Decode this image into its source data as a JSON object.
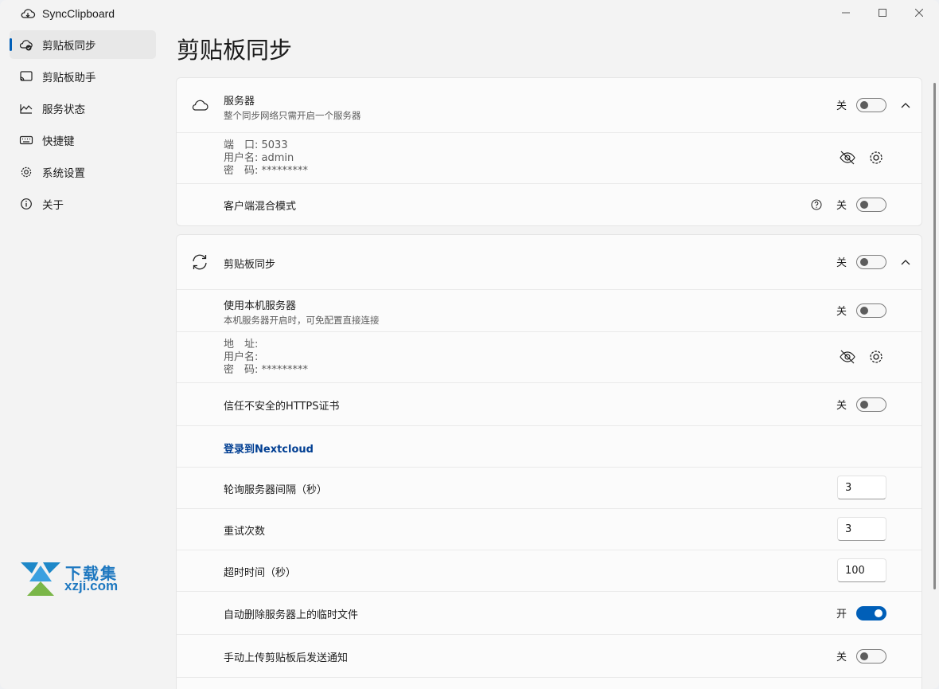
{
  "app": {
    "title": "SyncClipboard"
  },
  "nav": {
    "items": [
      {
        "label": "剪贴板同步"
      },
      {
        "label": "剪贴板助手"
      },
      {
        "label": "服务状态"
      },
      {
        "label": "快捷键"
      },
      {
        "label": "系统设置"
      },
      {
        "label": "关于"
      }
    ]
  },
  "page": {
    "title": "剪贴板同步"
  },
  "server": {
    "title": "服务器",
    "subtitle": "整个同步网络只需开启一个服务器",
    "state": "关",
    "info": {
      "port": "端　口: 5033",
      "user": "用户名: admin",
      "password": "密　码: *********"
    },
    "client_mixed_label": "客户端混合模式",
    "client_mixed_state": "关"
  },
  "sync": {
    "title": "剪贴板同步",
    "state": "关",
    "local_server": {
      "label": "使用本机服务器",
      "sub": "本机服务器开启时，可免配置直接连接",
      "state": "关"
    },
    "info": {
      "address": "地　址:",
      "user": "用户名:",
      "password": "密　码: *********"
    },
    "trust_https": {
      "label": "信任不安全的HTTPS证书",
      "state": "关"
    },
    "nextcloud_link": "登录到Nextcloud",
    "poll_interval": {
      "label": "轮询服务器间隔（秒）",
      "value": "3"
    },
    "retry_count": {
      "label": "重试次数",
      "value": "3"
    },
    "timeout": {
      "label": "超时时间（秒）",
      "value": "100"
    },
    "auto_delete": {
      "label": "自动删除服务器上的临时文件",
      "state": "开"
    },
    "manual_notify": {
      "label": "手动上传剪贴板后发送通知",
      "state": "关"
    }
  },
  "watermark": {
    "cn": "下载集",
    "url": "xzji.com"
  },
  "colors": {
    "accent": "#005fb8",
    "link": "#003e92",
    "window_bg": "#f3f3f3",
    "card_bg": "#fbfbfb"
  }
}
